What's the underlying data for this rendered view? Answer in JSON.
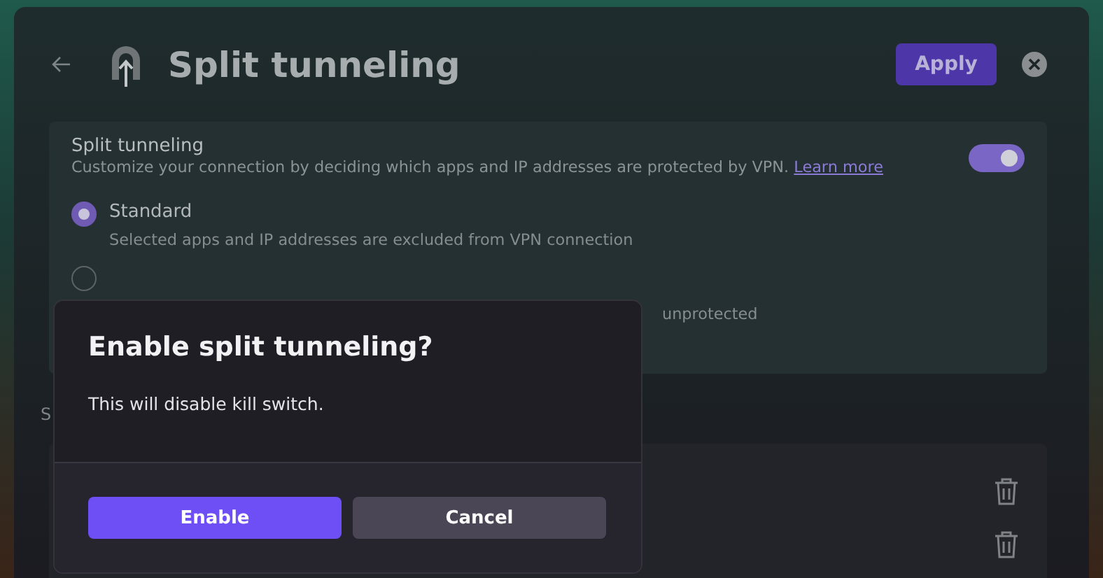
{
  "header": {
    "title": "Split tunneling",
    "apply_button": "Apply"
  },
  "split_tunneling": {
    "title": "Split tunneling",
    "description": "Customize your connection by deciding which apps and IP addresses are protected by VPN.",
    "link": "Learn more",
    "on": true
  },
  "modes": [
    {
      "label": "Standard",
      "description": "Selected apps and IP addresses are excluded from VPN connection",
      "selected": true
    },
    {
      "description": "unprotected",
      "selected": false
    }
  ],
  "section": {
    "title": "S",
    "rows": [
      {
        "kind": "trash"
      },
      {
        "kind": "trash"
      }
    ]
  },
  "dialog": {
    "title": "Enable split tunneling?",
    "message": "This will disable kill switch.",
    "buttons": [
      {
        "label": "Enable",
        "kind": "primary"
      },
      {
        "label": "Cancel",
        "kind": "secondary"
      }
    ]
  }
}
